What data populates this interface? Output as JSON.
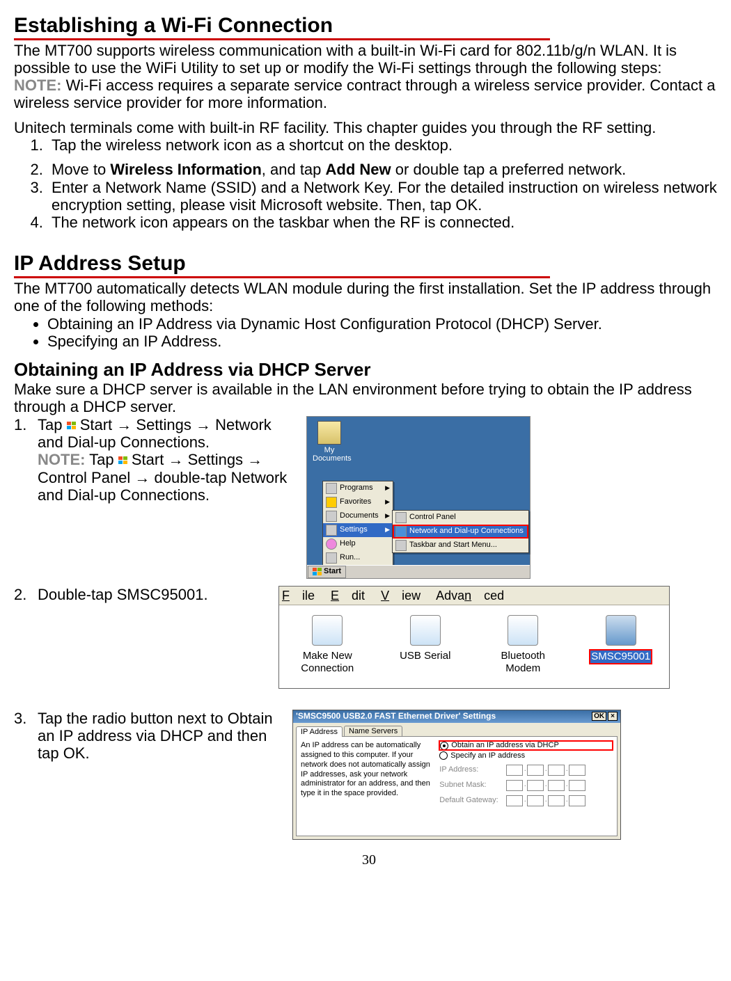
{
  "page_number": "30",
  "sec1_title": "Establishing a Wi-Fi Connection",
  "sec1_p1": "The MT700 supports wireless communication with a built-in Wi-Fi card for 802.11b/g/n WLAN. It is possible to use the WiFi Utility to set up or modify the Wi-Fi settings through the following steps:",
  "note_label": "NOTE:",
  "sec1_note": " Wi-Fi access requires a separate service contract through a wireless service provider. Contact a wireless service provider for more information.",
  "sec1_p2": "Unitech terminals come with built-in RF facility. This chapter guides you through the RF setting.",
  "sec1_step1": "Tap the wireless network icon as a shortcut on the desktop.",
  "sec1_step2_pre": "Move to ",
  "sec1_step2_b1": "Wireless Information",
  "sec1_step2_mid": ", and tap ",
  "sec1_step2_b2": "Add New",
  "sec1_step2_post": " or double tap a preferred network.",
  "sec1_step3": "Enter a Network Name (SSID) and a Network Key. For the detailed instruction on wireless network encryption setting, please visit Microsoft website. Then, tap OK.",
  "sec1_step4": "The network icon appears on the taskbar when the RF is connected.",
  "sec2_title": "IP Address Setup",
  "sec2_p1": "The MT700 automatically detects WLAN module during the first installation. Set the IP address through one of the following methods:",
  "sec2_b1": "Obtaining an IP Address via Dynamic Host Configuration Protocol (DHCP) Server.",
  "sec2_b2": "Specifying an IP Address.",
  "sec3_title": "Obtaining an IP Address via DHCP Server",
  "sec3_p1": "Make sure a DHCP server is available in the LAN environment before trying to obtain the IP address through a DHCP server.",
  "dhcp_s1_a": "Tap ",
  "dhcp_s1_b": " Start → Settings → Network and Dial-up Connections.",
  "dhcp_s1_note_a": "Tap ",
  "dhcp_s1_note_b": " Start → Settings → Control Panel → double-tap Network and Dial-up Connections.",
  "dhcp_s2": "Double-tap SMSC95001.",
  "dhcp_s3": "Tap the radio button next to Obtain an IP address via DHCP and then tap OK.",
  "desktop": {
    "icon_label": "My Documents",
    "menu": {
      "programs": "Programs",
      "favorites": "Favorites",
      "documents": "Documents",
      "settings": "Settings",
      "help": "Help",
      "run": "Run..."
    },
    "submenu": {
      "cp": "Control Panel",
      "ndc": "Network and Dial-up Connections",
      "tsm": "Taskbar and Start Menu..."
    },
    "start": "Start"
  },
  "ncwin": {
    "file": "File",
    "edit": "Edit",
    "view": "View",
    "adv": "Advanced",
    "i1": "Make New Connection",
    "i2": "USB Serial",
    "i3": "Bluetooth Modem",
    "i4": "SMSC95001"
  },
  "ipdlg": {
    "title": "'SMSC9500 USB2.0 FAST Ethernet Driver' Settings",
    "ok": "OK",
    "tab1": "IP Address",
    "tab2": "Name Servers",
    "help": "An IP address can be automatically assigned to this computer. If your network does not automatically assign IP addresses, ask your network administrator for an address, and then type it in the space provided.",
    "r1": "Obtain an IP address via DHCP",
    "r2": "Specify an IP address",
    "f1": "IP Address:",
    "f2": "Subnet Mask:",
    "f3": "Default Gateway:"
  }
}
